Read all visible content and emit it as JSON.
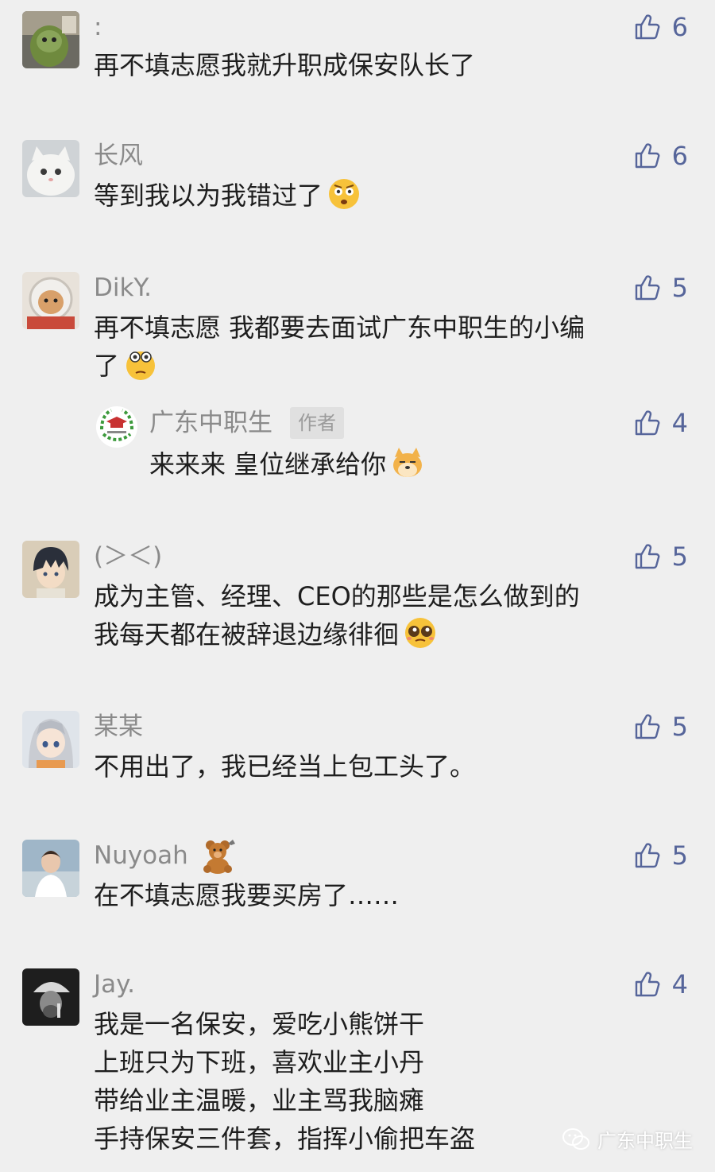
{
  "colors": {
    "background": "#efefef",
    "nickname": "#8a8a8a",
    "comment_text": "#1e1e1e",
    "like_accent": "#56659a"
  },
  "comments": [
    {
      "nickname": ":",
      "avatar_icon": "green-plush-toy-avatar",
      "lines": [
        "再不填志愿我就升职成保安队长了"
      ],
      "likes": "6"
    },
    {
      "nickname": "长风",
      "avatar_icon": "white-cat-avatar",
      "lines": [
        "等到我以为我错过了"
      ],
      "emoji": "shocked-face-emoji",
      "likes": "6"
    },
    {
      "nickname": "DikY.",
      "avatar_icon": "astronaut-cat-avatar",
      "lines": [
        "再不填志愿 我都要去面试广东中职生的小编",
        "了"
      ],
      "emoji": "wide-eyed-face-emoji",
      "likes": "5",
      "reply": {
        "nickname": "广东中职生",
        "badge": "作者",
        "avatar_icon": "school-emblem-avatar",
        "text": "来来来 皇位继承给你",
        "emoji": "doge-emoji",
        "likes": "4"
      }
    },
    {
      "nickname": "(＞＜)",
      "avatar_icon": "anime-boy-avatar",
      "lines": [
        "成为主管、经理、CEO的那些是怎么做到的",
        "我每天都在被辞退边缘徘徊"
      ],
      "emoji": "pleading-face-emoji",
      "likes": "5"
    },
    {
      "nickname": "某某",
      "avatar_icon": "anime-girl-avatar",
      "lines": [
        "不用出了，我已经当上包工头了。"
      ],
      "likes": "5"
    },
    {
      "nickname": "Nuyoah",
      "avatar_icon": "woman-portrait-avatar",
      "nickname_icon": "teddy-bear-icon",
      "lines": [
        "在不填志愿我要买房了……"
      ],
      "likes": "5"
    },
    {
      "nickname": "Jay.",
      "avatar_icon": "man-with-cap-avatar",
      "lines": [
        "我是一名保安，爱吃小熊饼干",
        "上班只为下班，喜欢业主小丹",
        "带给业主温暖，业主骂我脑瘫",
        "手持保安三件套，指挥小偷把车盗"
      ],
      "likes": "4"
    }
  ],
  "watermark": {
    "icon": "wechat-logo-icon",
    "text": "广东中职生"
  }
}
